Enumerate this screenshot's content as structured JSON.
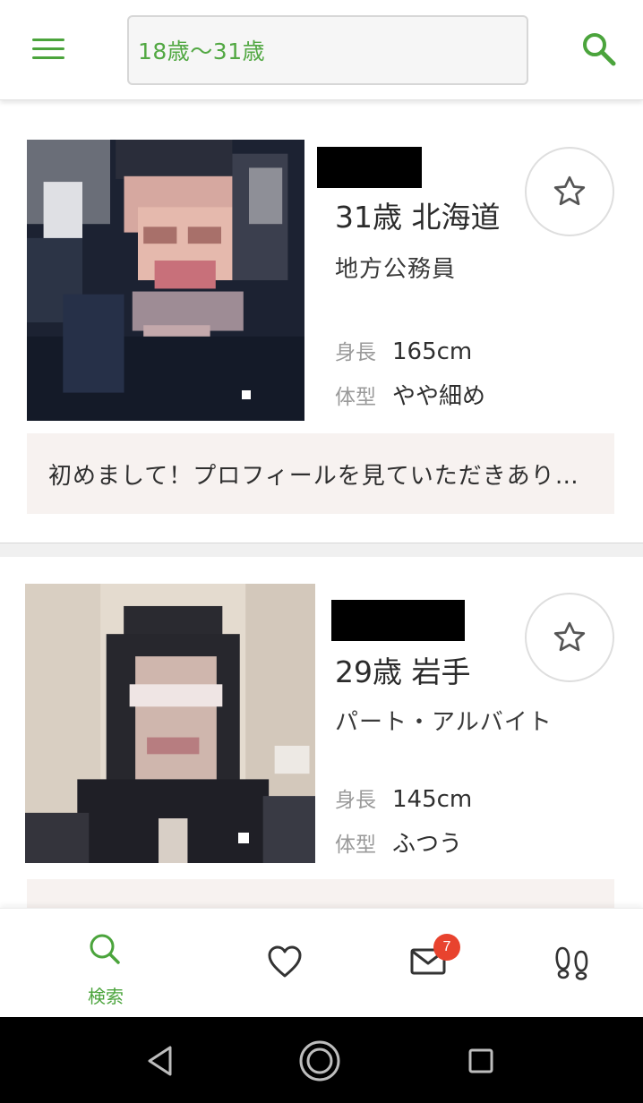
{
  "app": {
    "search_filter": "18歳〜31歳",
    "icons": {
      "menu": "hamburger-icon",
      "search": "search-icon"
    }
  },
  "profiles": [
    {
      "age_prefecture": "31歳 北海道",
      "occupation": "地方公務員",
      "height_label": "身長",
      "height_value": "165cm",
      "body_label": "体型",
      "body_value": "やや細め",
      "message": "初めまして！プロフィールを見ていただきあり…"
    },
    {
      "age_prefecture": "29歳 岩手",
      "occupation": "パート・アルバイト",
      "height_label": "身長",
      "height_value": "145cm",
      "body_label": "体型",
      "body_value": "ふつう",
      "message": ""
    }
  ],
  "bottom_nav": {
    "search_label": "検索",
    "message_badge": "7",
    "items": [
      "search-icon",
      "heart-icon",
      "mail-icon",
      "footprints-icon"
    ]
  },
  "colors": {
    "accent": "#4ba43c",
    "badge": "#e8432e",
    "message_bg": "#f7f2f0"
  }
}
